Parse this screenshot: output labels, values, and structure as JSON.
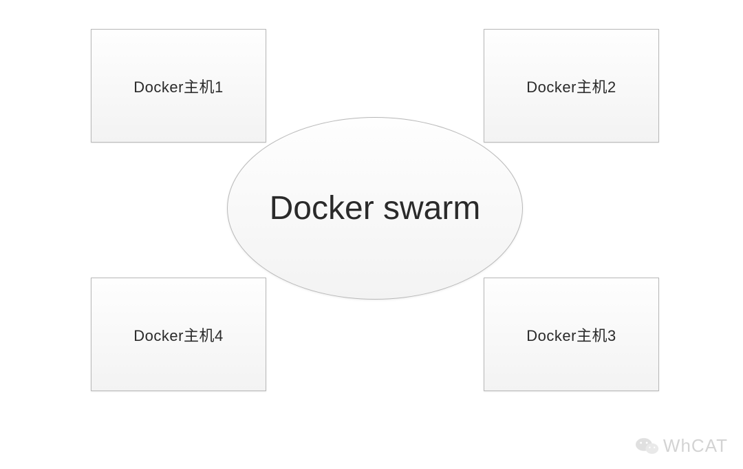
{
  "center": {
    "label": "Docker swarm"
  },
  "hosts": {
    "top_left": "Docker主机1",
    "top_right": "Docker主机2",
    "bottom_right": "Docker主机3",
    "bottom_left": "Docker主机4"
  },
  "watermark": {
    "text": "WhCAT"
  }
}
